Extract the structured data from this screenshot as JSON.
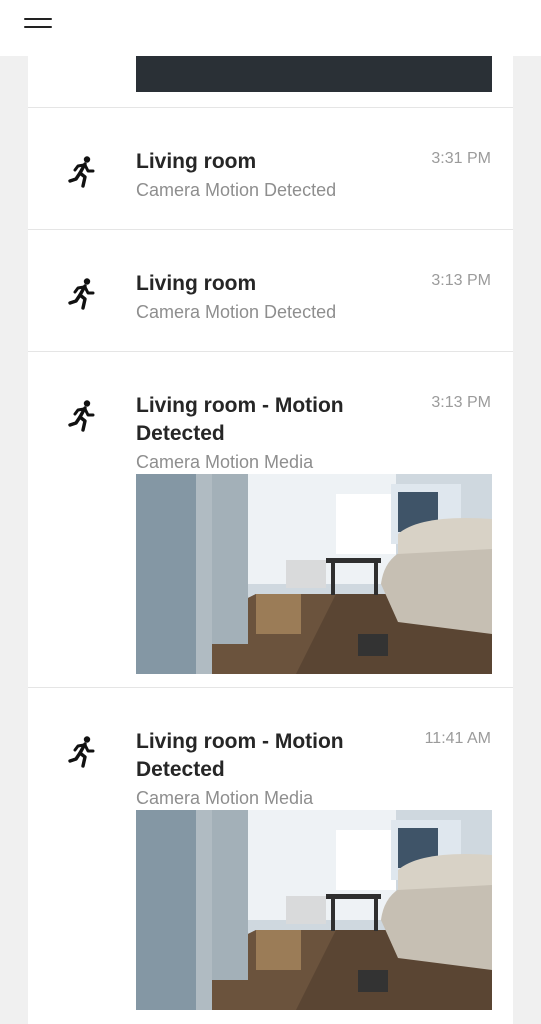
{
  "header": {
    "menu_icon": "hamburger-menu-icon"
  },
  "events": [
    {
      "title": "Living room",
      "subtitle": "Camera Motion Detected",
      "time": "3:31 PM",
      "icon": "running-person-icon"
    },
    {
      "title": "Living room",
      "subtitle": "Camera Motion Detected",
      "time": "3:13 PM",
      "icon": "running-person-icon"
    },
    {
      "title": "Living room - Motion Detected",
      "subtitle": "Camera Motion Media",
      "time": "3:13 PM",
      "icon": "running-person-icon"
    },
    {
      "title": "Living room - Motion Detected",
      "subtitle": "Camera Motion Media",
      "time": "11:41 AM",
      "icon": "running-person-icon"
    }
  ],
  "colors": {
    "title": "#262626",
    "subtitle": "#8e8e8e",
    "time": "#9b9b9b",
    "background": "#f0f0f0",
    "card": "#ffffff"
  }
}
